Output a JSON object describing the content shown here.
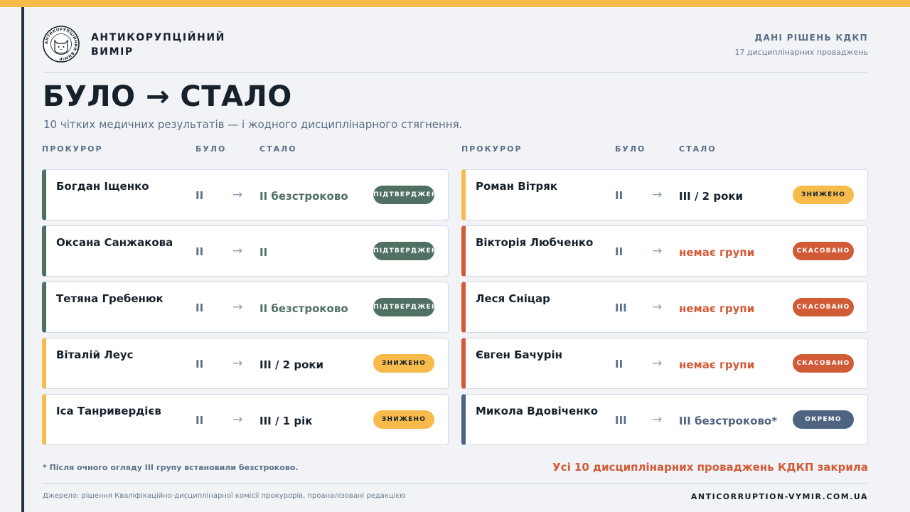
{
  "brand": {
    "line1": "АНТИКОРУПЦІЙНИЙ",
    "line2": "ВИМІР",
    "logo_text": "АНТИКОРУПЦІЙНИЙ ВИМІР"
  },
  "source_box": {
    "title": "ДАНІ РІШЕНЬ КДКП",
    "subtitle": "17 дисциплінарних проваджень"
  },
  "headline": "БУЛО → СТАЛО",
  "subtitle": "10 чітких медичних результатів — і жодного дисциплінарного стягнення.",
  "columns": {
    "name": "ПРОКУРОР",
    "before": "БУЛО",
    "after": "СТАЛО"
  },
  "arrow": "→",
  "left_cards": [
    {
      "name": "Богдан Іщенко",
      "before": "II",
      "after": "II безстроково",
      "after_style": "green",
      "badge": "ПІДТВЕРДЖЕНО",
      "status": "green"
    },
    {
      "name": "Оксана Санжакова",
      "before": "II",
      "after": "II",
      "after_style": "green",
      "badge": "ПІДТВЕРДЖЕНО",
      "status": "green"
    },
    {
      "name": "Тетяна Гребенюк",
      "before": "II",
      "after": "II безстроково",
      "after_style": "green",
      "badge": "ПІДТВЕРДЖЕНО",
      "status": "green"
    },
    {
      "name": "Віталій Леус",
      "before": "II",
      "after": "III / 2 роки",
      "after_style": "dark",
      "badge": "ЗНИЖЕНО",
      "status": "yellow"
    },
    {
      "name": "Іса Танривердієв",
      "before": "II",
      "after": "III / 1 рік",
      "after_style": "dark",
      "badge": "ЗНИЖЕНО",
      "status": "yellow"
    }
  ],
  "right_cards": [
    {
      "name": "Роман Вітряк",
      "before": "II",
      "after": "III / 2 роки",
      "after_style": "dark",
      "badge": "ЗНИЖЕНО",
      "status": "yellow"
    },
    {
      "name": "Вікторія Любченко",
      "before": "II",
      "after": "немає групи",
      "after_style": "red",
      "badge": "СКАСОВАНО",
      "status": "red"
    },
    {
      "name": "Леся Сніцар",
      "before": "III",
      "after": "немає групи",
      "after_style": "red",
      "badge": "СКАСОВАНО",
      "status": "red"
    },
    {
      "name": "Євген Бачурін",
      "before": "II",
      "after": "немає групи",
      "after_style": "red",
      "badge": "СКАСОВАНО",
      "status": "red"
    },
    {
      "name": "Микола Вдовіченко",
      "before": "III",
      "after": "III безстроково*",
      "after_style": "blue",
      "badge": "ОКРЕМО",
      "status": "blue"
    }
  ],
  "footnote": "* Після очного огляду III групу встановили безстроково.",
  "summary": "Усі 10 дисциплінарних проваджень КДКП закрила",
  "source": "Джерело: рішення Кваліфікаційно-дисциплінарної комісії прокурорів, проаналізовані редакцією",
  "site": "ANTICORRUPTION-VYMIR.COM.UA",
  "colors": {
    "accent_yellow": "#f6bb4a",
    "green": "#507061",
    "red": "#d25b37",
    "blue": "#4f6480",
    "navy": "#16212c"
  }
}
